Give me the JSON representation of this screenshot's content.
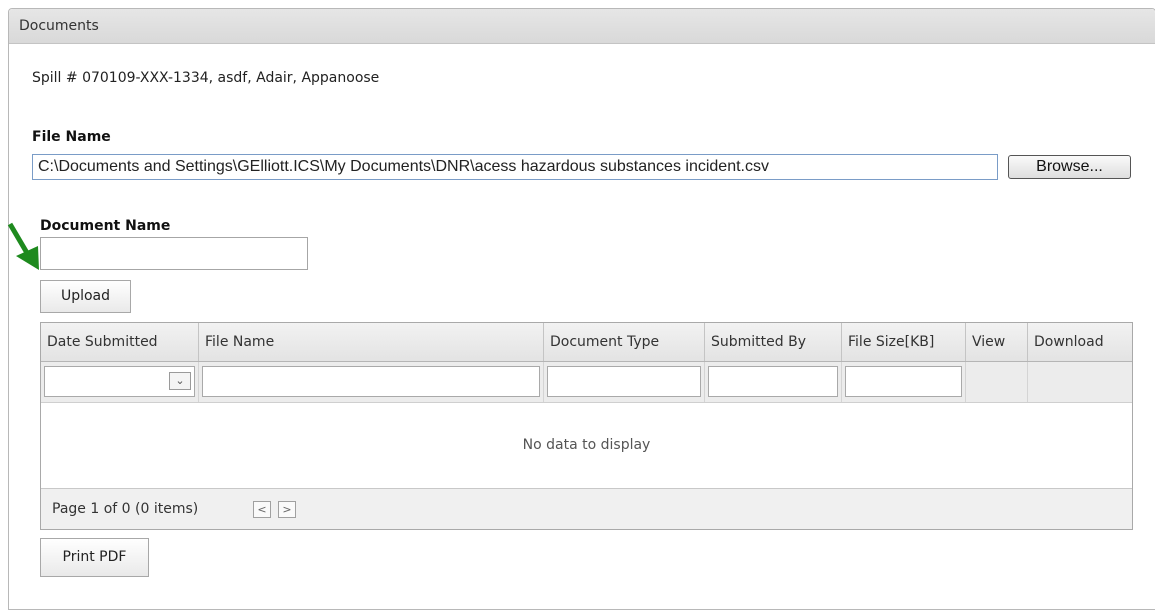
{
  "panel": {
    "title": "Documents"
  },
  "spill_info": "Spill # 070109-XXX-1334, asdf, Adair, Appanoose",
  "file_name": {
    "label": "File Name",
    "value": "C:\\Documents and Settings\\GElliott.ICS\\My Documents\\DNR\\acess hazardous substances incident.csv",
    "browse_label": "Browse..."
  },
  "document_name": {
    "label": "Document Name",
    "value": ""
  },
  "upload_label": "Upload",
  "grid": {
    "columns": [
      "Date Submitted",
      "File Name",
      "Document Type",
      "Submitted By",
      "File Size[KB]",
      "View",
      "Download"
    ],
    "empty_text": "No data to display",
    "pager_text": "Page 1 of 0 (0 items)",
    "prev_icon": "chevron-left-icon",
    "next_icon": "chevron-right-icon"
  },
  "print_label": "Print PDF",
  "colors": {
    "arrow": "#1e8a1e",
    "input_border": "#7a9cc7"
  }
}
